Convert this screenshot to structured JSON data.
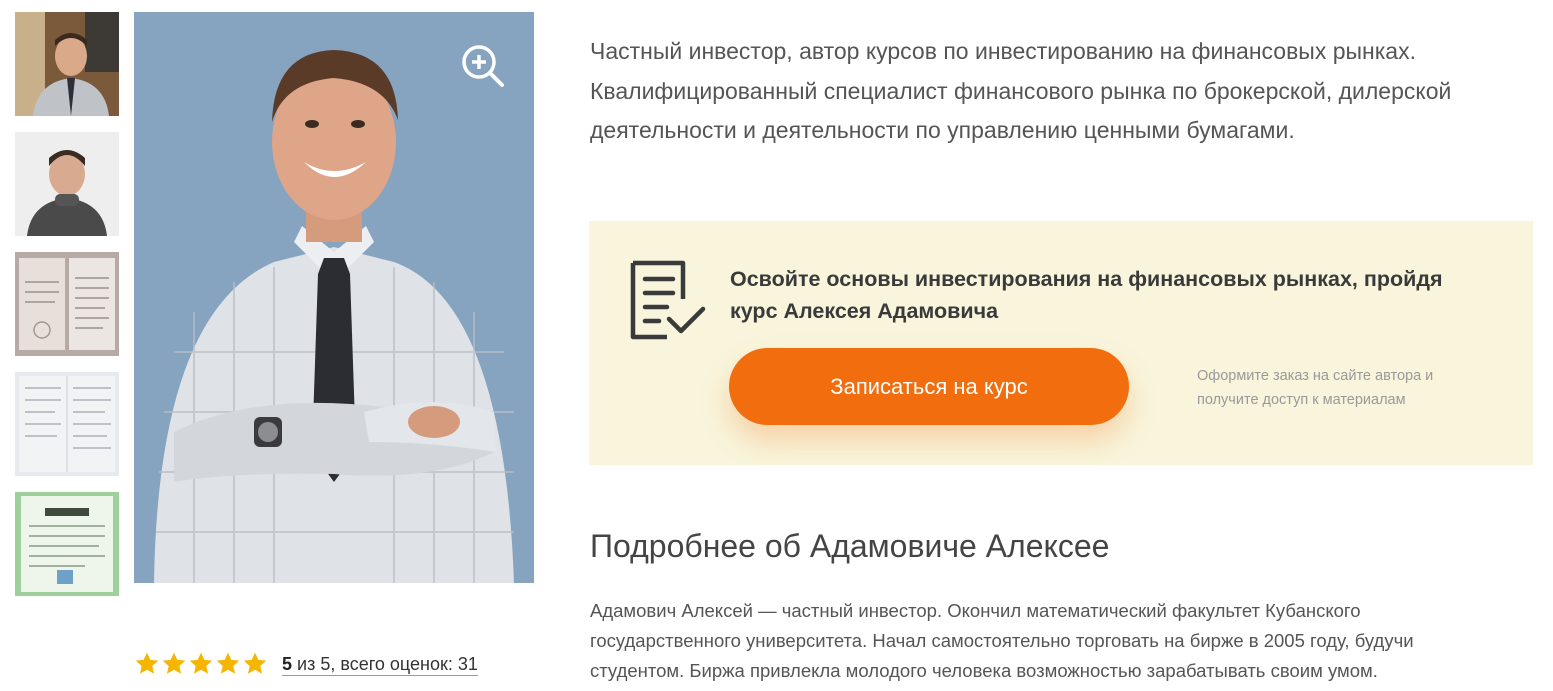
{
  "thumbnails": [
    {
      "name": "thumb-photo-office"
    },
    {
      "name": "thumb-photo-sweater"
    },
    {
      "name": "thumb-diploma"
    },
    {
      "name": "thumb-certificate"
    },
    {
      "name": "thumb-attestat"
    }
  ],
  "photo": {
    "background": "#86a3c0",
    "zoom_icon": "zoom-in-icon"
  },
  "rating": {
    "stars": 5,
    "value": "5",
    "text": " из 5, всего оценок: 31",
    "star_color": "#f5b500"
  },
  "intro": {
    "text": "Частный инвестор, автор курсов по инвестированию на финансовых рынках. Квалифицированный специалист финансового рынка по брокерской, дилерской деятельности и деятельности по управлению ценными бумагами."
  },
  "cta": {
    "title": "Освойте основы инвестирования на финансовых рынках, пройдя курс Алексея Адамовича",
    "button_label": "Записаться на курс",
    "note": "Оформите заказ на сайте автора и получите доступ к материалам",
    "icon": "document-check-icon",
    "accent": "#f26d0d",
    "background": "#f8f5dc"
  },
  "about": {
    "title": "Подробнее об Адамовиче Алексее",
    "text": "Адамович Алексей — частный инвестор. Окончил математический факультет Кубанского государственного университета. Начал самостоятельно торговать на бирже в 2005 году, будучи студентом. Биржа привлекла молодого человека возможностью зарабатывать своим умом."
  }
}
